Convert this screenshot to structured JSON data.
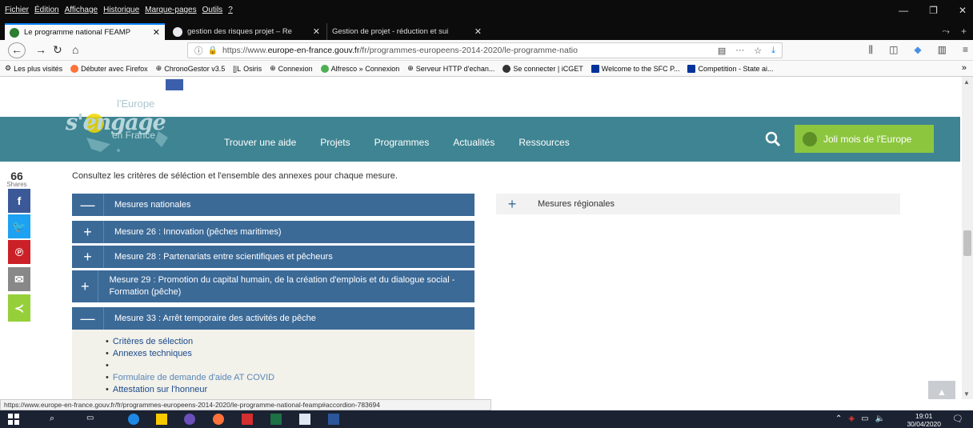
{
  "browser": {
    "menu": [
      "Fichier",
      "Édition",
      "Affichage",
      "Historique",
      "Marque-pages",
      "Outils",
      "?"
    ],
    "tabs": [
      {
        "label": "Le programme national FEAMP",
        "active": true
      },
      {
        "label": "gestion des risques projet – Re",
        "active": false
      },
      {
        "label": "Gestion de projet - réduction et sui",
        "active": false
      }
    ],
    "url_prefix": "https://www.",
    "url_domain": "europe-en-france.gouv.fr",
    "url_rest": "/fr/programmes-europeens-2014-2020/le-programme-natio",
    "url_more": "···",
    "bookmarks": [
      "Les plus visités",
      "Débuter avec Firefox",
      "ChronoGestor v3.5",
      "Osiris",
      "Connexion",
      "Alfresco » Connexion",
      "Serveur HTTP d'echan...",
      "Se connecter | iCGET",
      "Welcome to the SFC P...",
      "Competition - State ai..."
    ],
    "bookmarks_more": "»"
  },
  "site": {
    "logo_line1": "l'Europe",
    "logo_line2": "s'engage",
    "logo_line3": "en France",
    "nav": [
      "Trouver une aide",
      "Projets",
      "Programmes",
      "Actualités",
      "Ressources"
    ],
    "cta": "Joli mois de l'Europe",
    "share_count": "66",
    "share_label": "Shares",
    "intro": "Consultez les critères de séléction et l'ensemble des annexes pour chaque mesure."
  },
  "accordion": {
    "national": {
      "sign": "—",
      "label": "Mesures nationales"
    },
    "items": [
      {
        "sign": "+",
        "label": "Mesure 26 : Innovation (pêches maritimes)"
      },
      {
        "sign": "+",
        "label": "Mesure 28 : Partenariats entre scientifiques et pêcheurs"
      },
      {
        "sign": "+",
        "label": "Mesure 29 : Promotion du capital humain, de la création d'emplois et du dialogue social - Formation (pêche)"
      },
      {
        "sign": "—",
        "label": "Mesure 33 : Arrêt temporaire des activités de pêche"
      }
    ],
    "open_links": [
      "Critères de sélection",
      "Annexes techniques"
    ],
    "open_links2": [
      "Formulaire de demande d'aide AT COVID",
      "Attestation sur l'honneur"
    ],
    "regional": {
      "sign": "+",
      "label": "Mesures régionales"
    }
  },
  "status_url": "https://www.europe-en-france.gouv.fr/fr/programmes-europeens-2014-2020/le-programme-national-feamp#accordion-783694",
  "taskbar": {
    "time": "19:01",
    "date": "30/04/2020"
  },
  "colors": {
    "header_band": "#3f8492",
    "accordion": "#3c6a97",
    "cta": "#8cc63f",
    "facebook": "#3b5998",
    "twitter": "#1da1f2",
    "pinterest": "#cb2027",
    "email": "#888888",
    "sharethis": "#95d03a"
  }
}
